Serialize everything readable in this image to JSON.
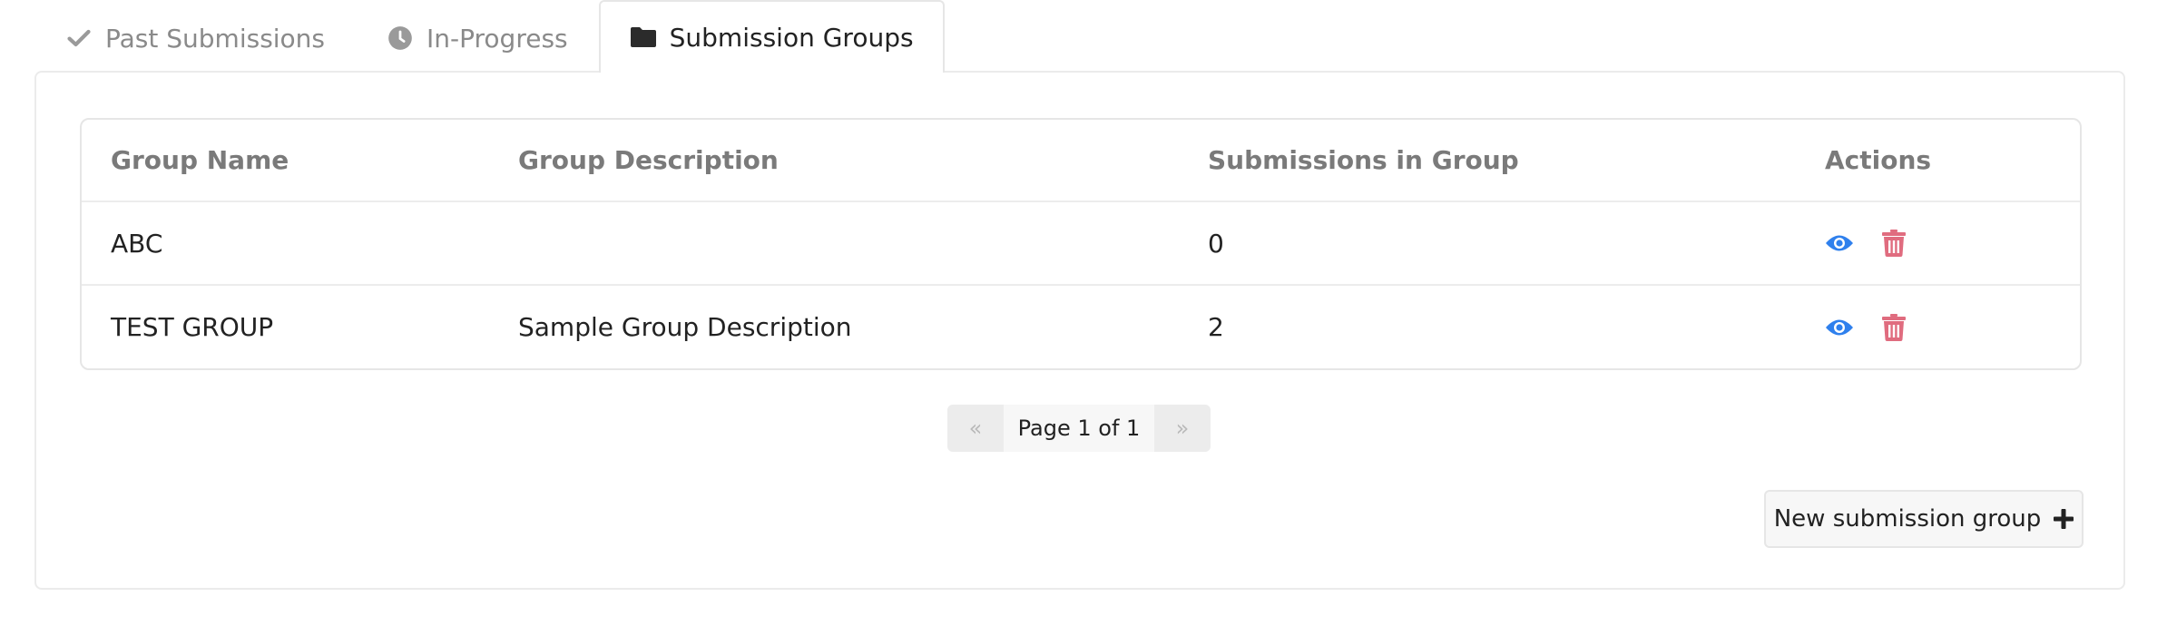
{
  "tabs": [
    {
      "label": "Past Submissions",
      "icon": "check-icon",
      "active": false
    },
    {
      "label": "In-Progress",
      "icon": "clock-icon",
      "active": false
    },
    {
      "label": "Submission Groups",
      "icon": "folder-icon",
      "active": true
    }
  ],
  "table": {
    "headers": [
      "Group Name",
      "Group Description",
      "Submissions in Group",
      "Actions"
    ],
    "rows": [
      {
        "name": "ABC",
        "description": "",
        "count": "0",
        "actions": [
          "eye-icon",
          "trash-icon"
        ]
      },
      {
        "name": "TEST GROUP",
        "description": "Sample Group Description",
        "count": "2",
        "actions": [
          "eye-icon",
          "trash-icon"
        ]
      }
    ]
  },
  "pagination": {
    "prev": "«",
    "label": "Page 1 of 1",
    "next": "»"
  },
  "new_group_button": {
    "label": "New submission group",
    "icon": "plus-icon"
  },
  "colors": {
    "view_icon": "#2f80ed",
    "delete_icon": "#e06c7f",
    "muted_text": "#8a8a8a",
    "header_text": "#7a7a7a"
  }
}
